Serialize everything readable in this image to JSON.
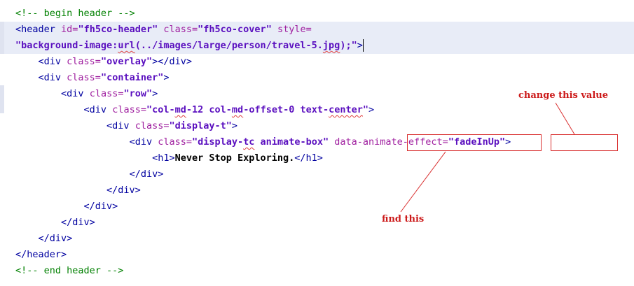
{
  "code": {
    "comment_begin": "<!-- begin header -->",
    "comment_end": "<!-- end header -->",
    "header_open": "<header",
    "header_close": "</header>",
    "header_id_attr": "id=",
    "header_id_val": "\"fh5co-header\"",
    "header_class_attr": "class=",
    "header_class_val": "\"fh5co-cover\"",
    "header_style_attr": "style=",
    "style_val_a": "\"background-image:",
    "style_val_url": "url",
    "style_val_b": "(../images/large/person/travel-5.",
    "style_val_jpg": "jpg",
    "style_val_c": ");\"",
    "gt": ">",
    "div_open": "<div",
    "div_close": "</div>",
    "class_attr": "class=",
    "overlay_val": "\"overlay\"",
    "container_val": "\"container\"",
    "row_val": "\"row\"",
    "col_val_a": "\"col-",
    "col_val_md": "md",
    "col_val_b": "-12 col-",
    "col_val_md2": "md",
    "col_val_c": "-offset-0 text-",
    "col_val_center": "center",
    "col_val_d": "\"",
    "display_t_val": "\"display-t\"",
    "display_tc_val_a": "\"display-",
    "display_tc_val_tc": "tc",
    "display_tc_val_b": " animate-box\"",
    "data_attr": "data-animate-effect",
    "eq": "=",
    "fade_val": "\"fadeInUp\"",
    "h1_open": "<h1>",
    "h1_text": "Never Stop Exploring.",
    "h1_close": "</h1>"
  },
  "annotations": {
    "change_label": "change this value",
    "find_label": "find this"
  }
}
